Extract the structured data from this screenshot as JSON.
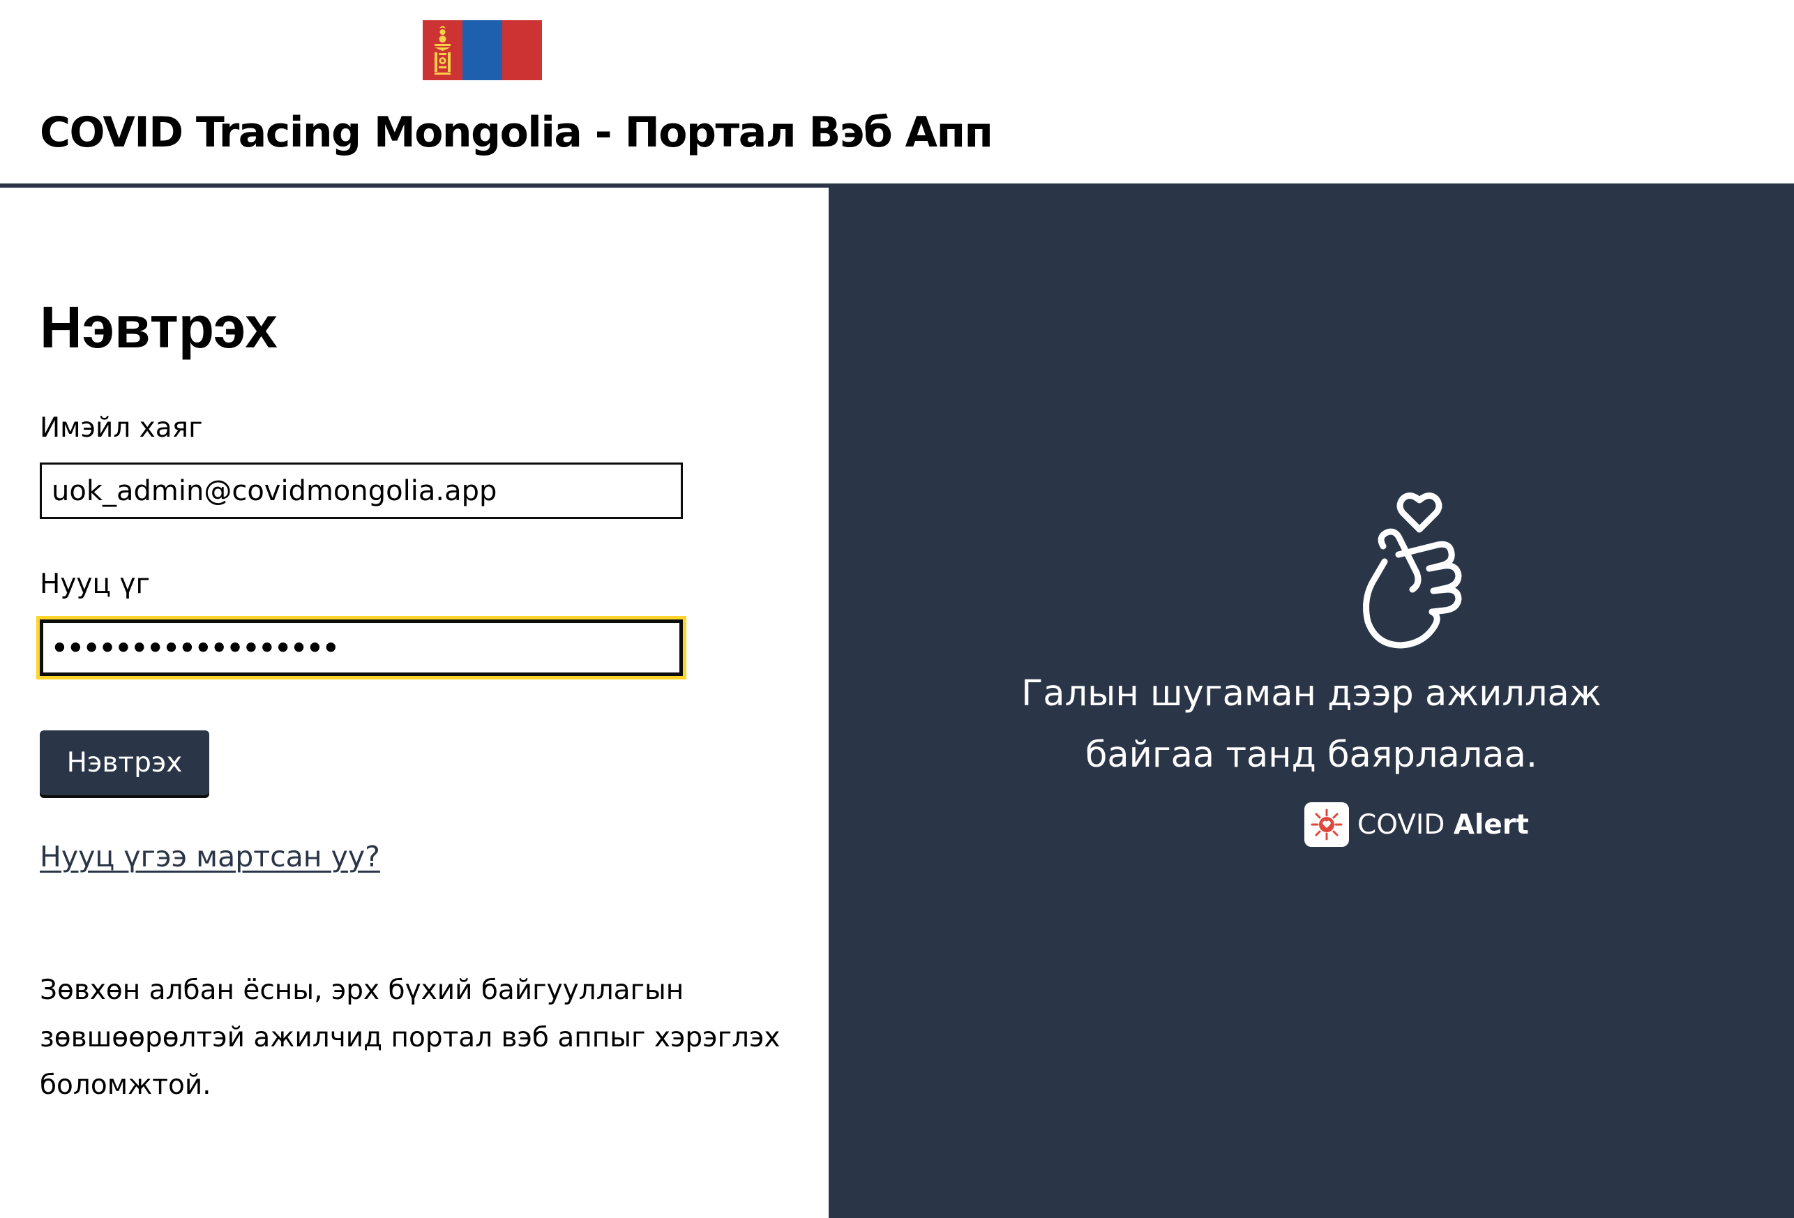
{
  "header": {
    "title": "COVID Tracing Mongolia - Портал Вэб Апп",
    "flag_icon": "mongolia-flag-icon",
    "colors": {
      "flag_red": "#cd3333",
      "flag_blue": "#1e5fae",
      "soyombo": "#f9d04a"
    }
  },
  "login": {
    "heading": "Нэвтрэх",
    "email_label": "Имэйл хаяг",
    "email_value": "uok_admin@covidmongolia.app",
    "password_label": "Нууц үг",
    "password_value": "••••••••••••••••••",
    "submit_label": "Нэвтрэх",
    "forgot_link": "Нууц үгээ мартсан уу?",
    "notice": "Зөвхөн албан ёсны, эрх бүхий байгууллагын зөвшөөрөлтэй ажилчид портал вэб аппыг хэрэглэх боломжтой."
  },
  "promo": {
    "icon": "finger-heart-icon",
    "thanks_line1": "Галын шугаман дээр ажиллаж",
    "thanks_line2": "байгаа танд баярлалаа.",
    "brand_icon": "covid-alert-logo-icon",
    "brand_prefix": "COVID",
    "brand_suffix": "Alert"
  },
  "theme": {
    "navy": "#2a3547",
    "focus_yellow": "#ffd52c",
    "text": "#0b0c0c"
  }
}
